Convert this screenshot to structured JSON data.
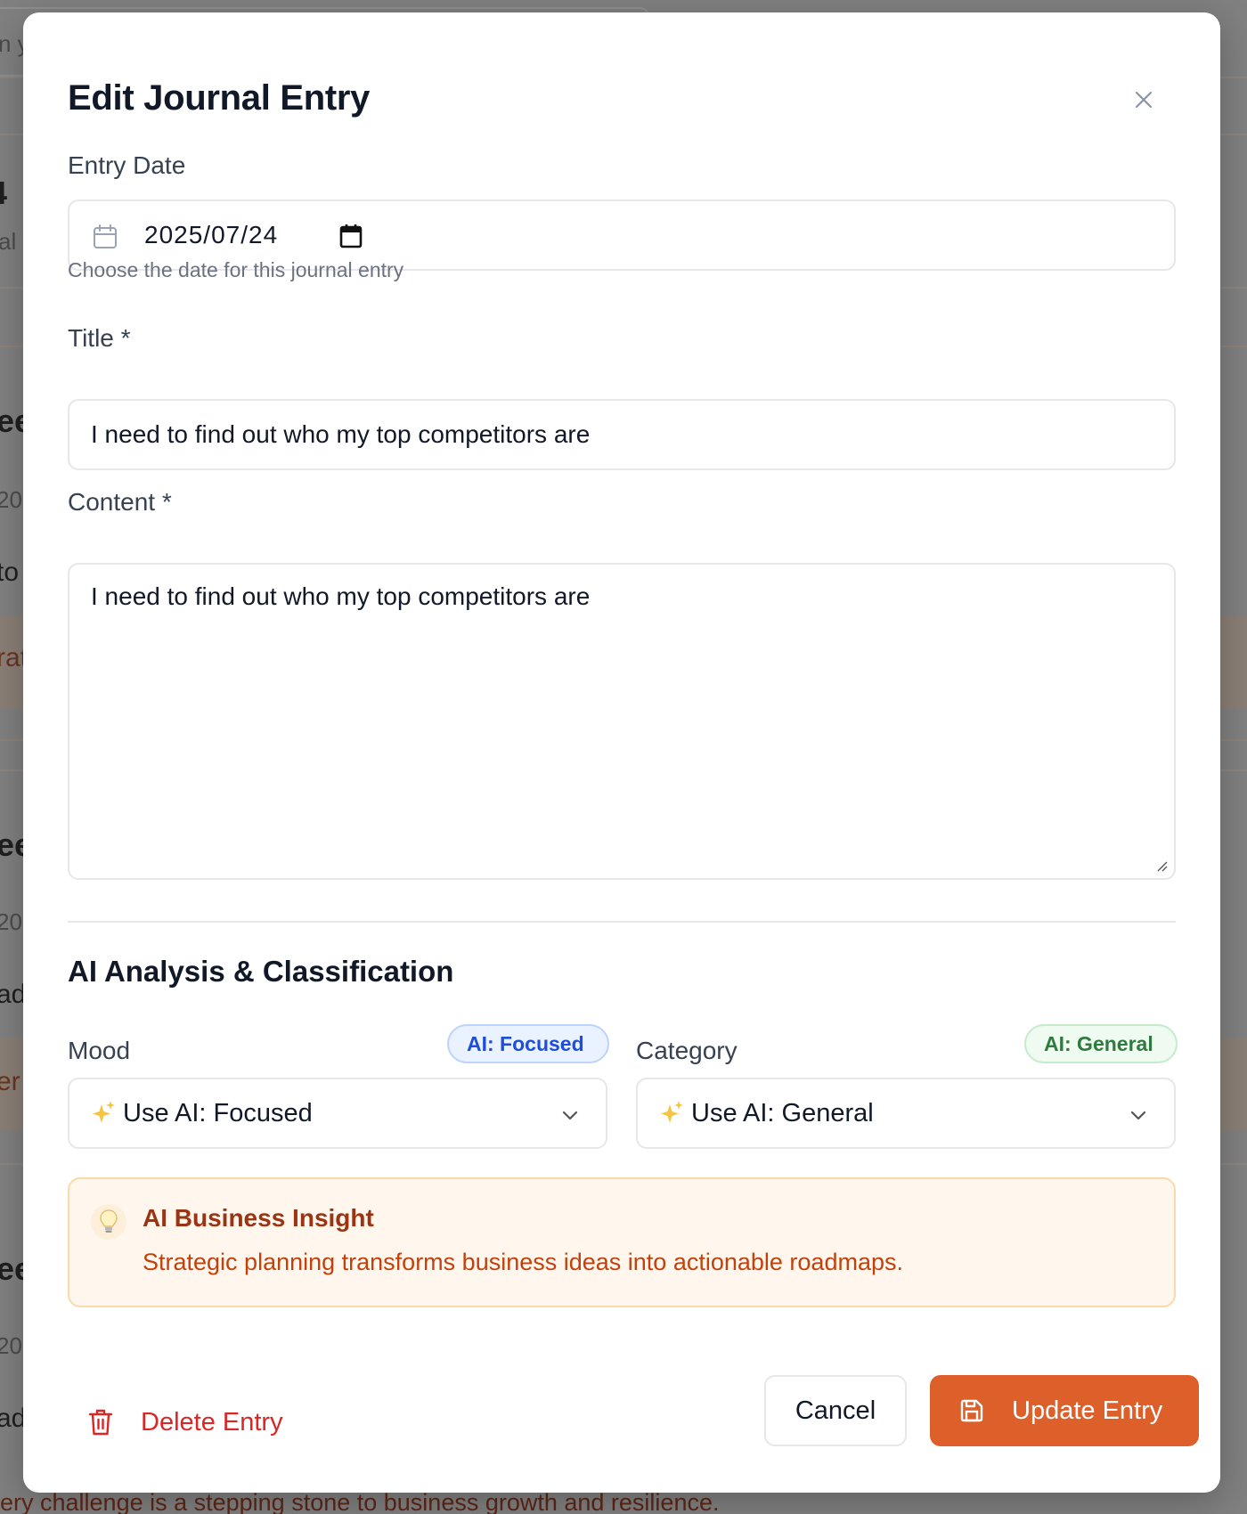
{
  "background": {
    "fragments": [
      "n y",
      "4",
      "al",
      "ee",
      "20",
      "to",
      "rat",
      "ee",
      "20",
      "ad",
      "er",
      "ee",
      "20",
      "ad"
    ],
    "bottom_text": "ery challenge is a stepping stone to business growth and resilience."
  },
  "modal": {
    "title": "Edit Journal Entry",
    "close_icon": "close-icon"
  },
  "entry_date": {
    "label": "Entry Date",
    "value": "2025/07/24",
    "hint": "Choose the date for this journal entry"
  },
  "title_field": {
    "label": "Title *",
    "value": "I need to find out who my top competitors are"
  },
  "content_field": {
    "label": "Content *",
    "value": "I need to find out who my top competitors are"
  },
  "ai_section": {
    "title": "AI Analysis & Classification",
    "mood": {
      "label": "Mood",
      "badge": "AI: Focused",
      "selected": "Use AI: Focused"
    },
    "category": {
      "label": "Category",
      "badge": "AI: General",
      "selected": "Use AI: General"
    }
  },
  "insight": {
    "title": "AI Business Insight",
    "text": "Strategic planning transforms business ideas into actionable roadmaps."
  },
  "actions": {
    "delete_label": "Delete Entry",
    "cancel_label": "Cancel",
    "update_label": "Update Entry"
  },
  "colors": {
    "accent": "#dd5f2a",
    "danger": "#dc2626",
    "badge_blue": "#1d4ed8",
    "badge_green": "#2f7a3d",
    "insight_title": "#9a3412",
    "insight_text": "#c2410c"
  }
}
